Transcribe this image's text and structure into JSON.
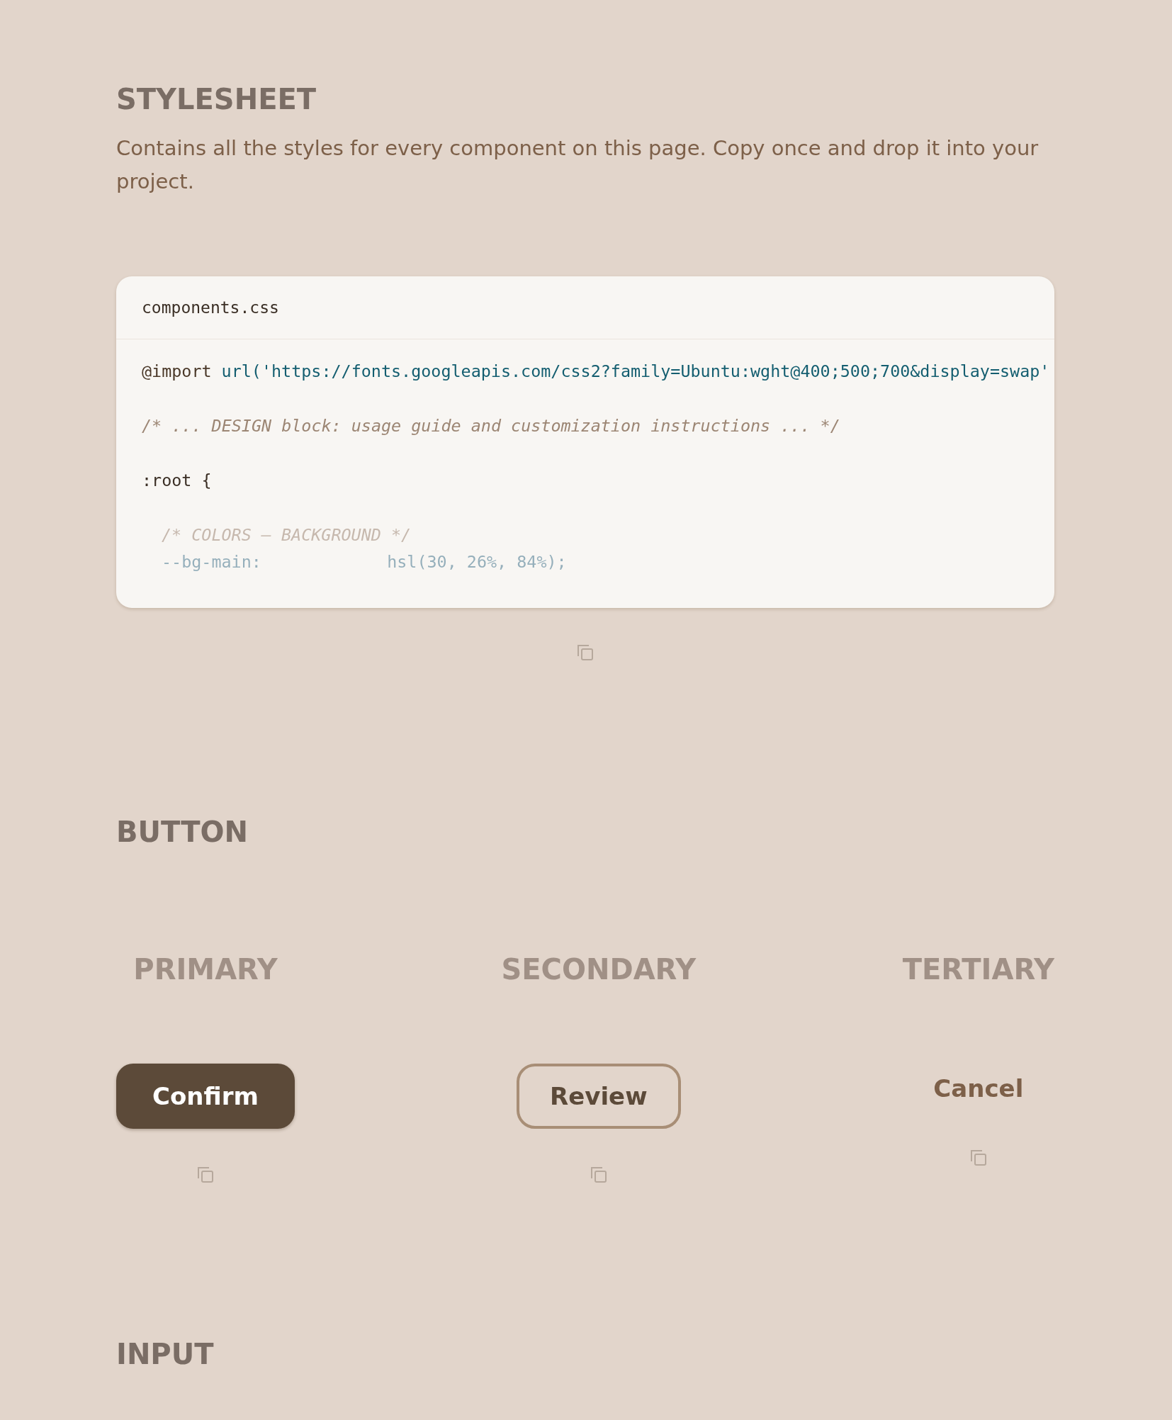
{
  "stylesheet": {
    "title": "STYLESHEET",
    "description": "Contains all the styles for every component on this page. Copy once and drop it into your project.",
    "code": {
      "filename": "components.css",
      "blocks": [
        [
          {
            "faded": false,
            "nested": false,
            "tokens": [
              {
                "kind": "atrule",
                "text": "@import"
              },
              {
                "kind": "url",
                "text": "url('https://fonts.googleapis.com/css2?family=Ubuntu:wght@400;500;700&display=swap'"
              }
            ]
          }
        ],
        [
          {
            "faded": false,
            "nested": false,
            "tokens": [
              {
                "kind": "comment",
                "text": "/* ... DESIGN block: usage guide and customization instructions ... */"
              }
            ]
          }
        ],
        [
          {
            "faded": false,
            "nested": false,
            "tokens": [
              {
                "kind": "selector",
                "text": ":root {"
              }
            ]
          }
        ],
        [
          {
            "faded": true,
            "nested": true,
            "tokens": [
              {
                "kind": "comment",
                "text": "/* COLORS – BACKGROUND */"
              }
            ]
          },
          {
            "faded": true,
            "nested": true,
            "tokens": [
              {
                "kind": "property",
                "text": "--bg-main:"
              },
              {
                "kind": "value",
                "text": "hsl(30, 26%, 84%);"
              }
            ]
          }
        ]
      ]
    }
  },
  "button": {
    "title": "BUTTON",
    "variants": [
      {
        "label": "PRIMARY",
        "kind": "primary",
        "button": "Confirm"
      },
      {
        "label": "SECONDARY",
        "kind": "secondary",
        "button": "Review"
      },
      {
        "label": "TERTIARY",
        "kind": "tertiary",
        "button": "Cancel"
      }
    ]
  },
  "input": {
    "title": "INPUT"
  }
}
